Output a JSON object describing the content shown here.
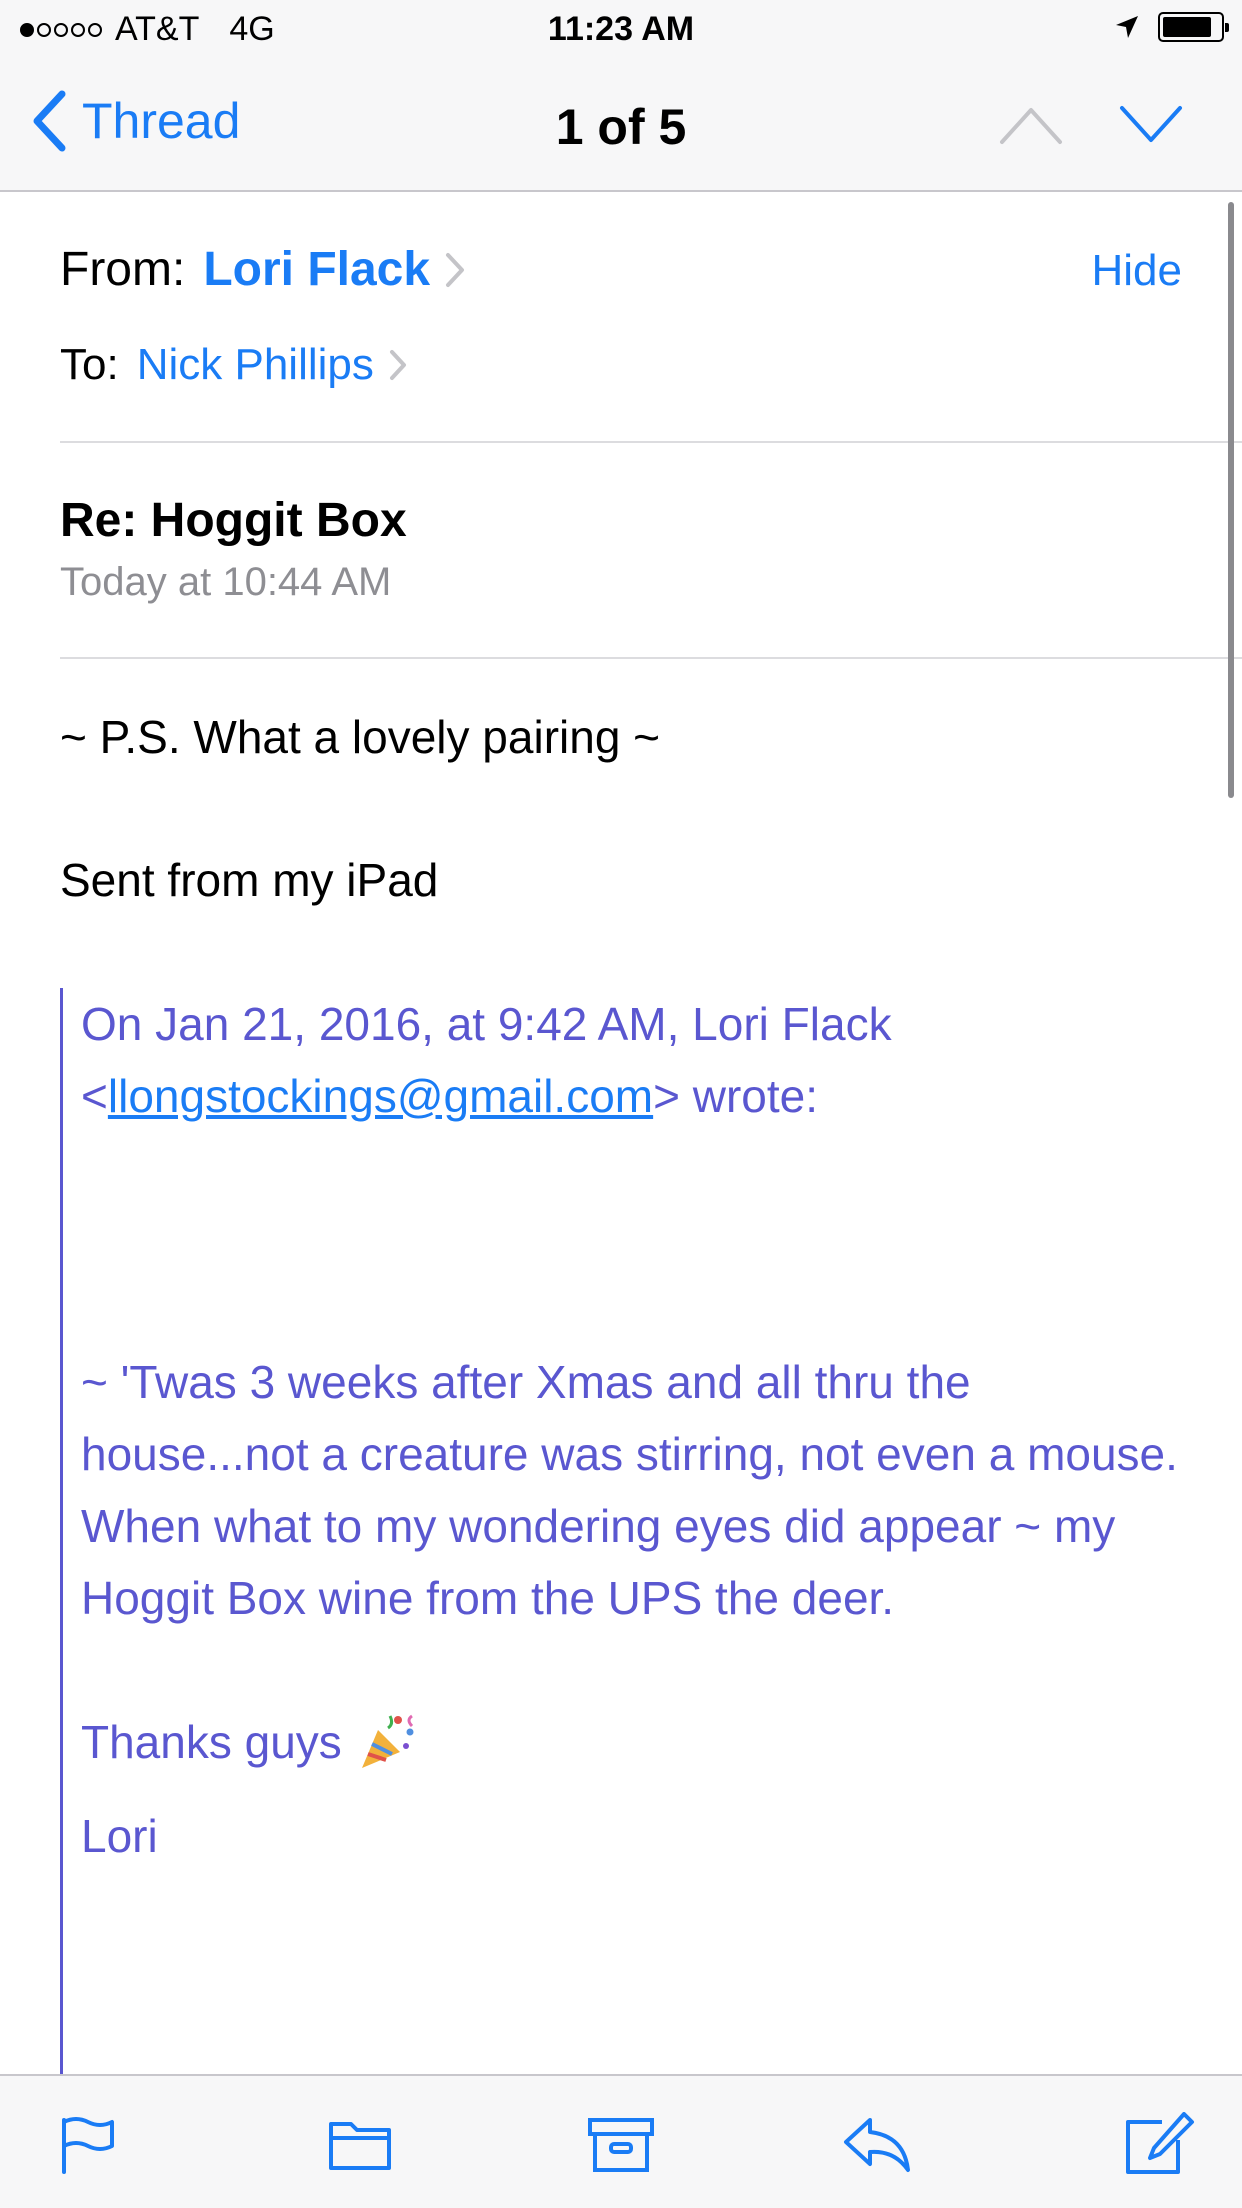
{
  "status_bar": {
    "carrier": "AT&T",
    "network": "4G",
    "time": "11:23 AM",
    "signal_bars": 1,
    "signal_total": 5,
    "battery_level": 0.85
  },
  "nav": {
    "back_label": "Thread",
    "title": "1 of 5"
  },
  "header": {
    "from_label": "From:",
    "from_name": "Lori Flack",
    "hide_label": "Hide",
    "to_label": "To:",
    "to_name": "Nick Phillips",
    "subject": "Re: Hoggit Box",
    "date": "Today at 10:44 AM"
  },
  "body": {
    "line1": "~ P.S. What a lovely pairing ~",
    "line2": "Sent from my iPad",
    "quote": {
      "header_prefix": "On Jan 21, 2016, at 9:42 AM, Lori Flack <",
      "email": "llongstockings@gmail.com",
      "header_suffix": "> wrote:",
      "message": "~ 'Twas 3 weeks after Xmas and all thru the house...not a creature was stirring, not even a mouse.  When what to my wondering eyes did appear ~ my Hoggit Box wine from the UPS the deer.",
      "thanks": "Thanks guys",
      "signoff": "Lori"
    }
  },
  "colors": {
    "accent": "#1a7cf5",
    "quote": "#5a57d0",
    "secondary_text": "#8e8e93",
    "bar_background": "#f7f7f8"
  },
  "icons": [
    "location-arrow-icon",
    "battery-icon",
    "chevron-left-icon",
    "chevron-up-icon",
    "chevron-down-icon",
    "chevron-right-icon",
    "party-popper-icon",
    "flag-icon",
    "folder-icon",
    "archive-icon",
    "reply-icon",
    "compose-icon"
  ]
}
